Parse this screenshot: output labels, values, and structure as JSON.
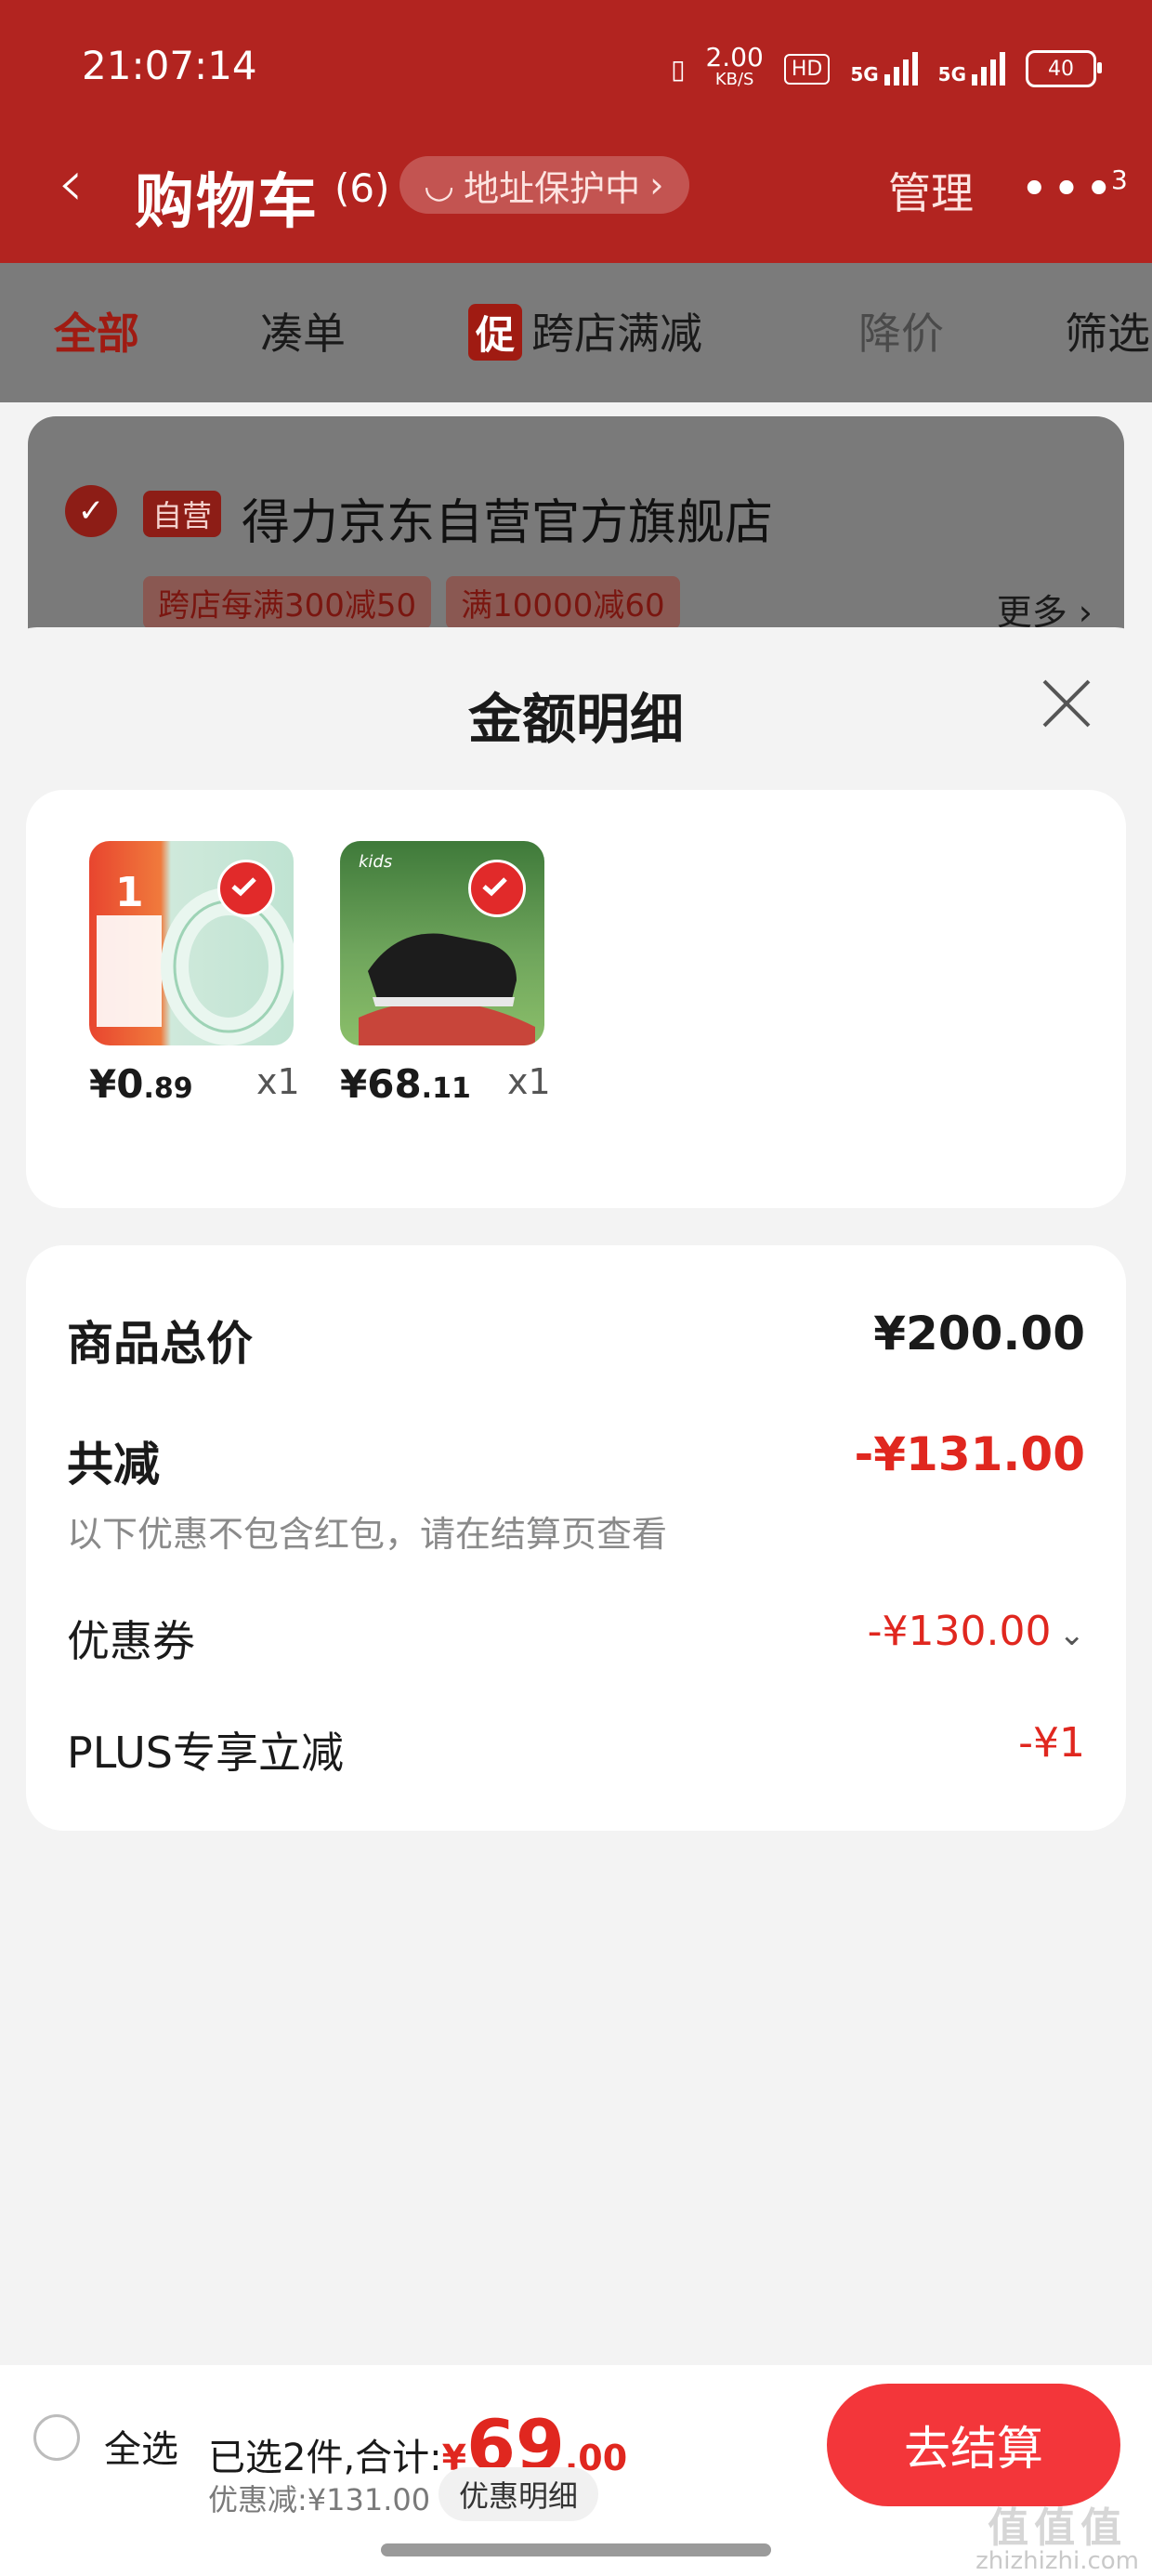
{
  "status_bar": {
    "time": "21:07:14",
    "net_speed": "2.00",
    "net_unit": "KB/S",
    "hd": "HD",
    "sig1": "5G",
    "sig2": "5G",
    "battery": "40"
  },
  "nav": {
    "back_icon": "chevron-left-icon",
    "title": "购物车",
    "count": "(6)",
    "address": "地址保护中",
    "manage": "管理",
    "more_badge": "3"
  },
  "tabs": [
    {
      "label": "全部",
      "active": true
    },
    {
      "label": "凑单"
    },
    {
      "badge": "促",
      "label": "跨店满减"
    },
    {
      "label": "降价",
      "disabled": true
    },
    {
      "label": "筛选"
    }
  ],
  "store": {
    "self_tag": "自营",
    "name": "得力京东自营官方旗舰店",
    "tags": [
      "跨店每满300减50",
      "满10000减60"
    ],
    "more": "更多"
  },
  "sheet": {
    "title": "金额明细",
    "products": [
      {
        "price_int": "¥0",
        "price_dec": ".89",
        "qty": "x1",
        "thumb_text": "1"
      },
      {
        "price_int": "¥68",
        "price_dec": ".11",
        "qty": "x1",
        "thumb_text": "kids"
      }
    ],
    "summary": {
      "total_label": "商品总价",
      "total_value": "¥200.00",
      "reduce_label": "共减",
      "reduce_value": "-¥131.00",
      "hint": "以下优惠不包含红包，请在结算页查看",
      "coupon_label": "优惠券",
      "coupon_value": "-¥130.00",
      "plus_label": "PLUS专享立减",
      "plus_value": "-¥1"
    }
  },
  "bottom": {
    "select_all": "全选",
    "selected_prefix": "已选2件,合计:",
    "currency": "¥",
    "total_int": "69",
    "total_dec": ".00",
    "discount": "优惠减:¥131.00",
    "detail_btn": "优惠明细",
    "checkout": "去结算",
    "watermark_big": "值值值",
    "watermark_small": "zhizhizhi.com"
  },
  "colors": {
    "brand_red": "#b22420",
    "price_red": "#e0271f",
    "checkout_red": "#f3363a"
  }
}
